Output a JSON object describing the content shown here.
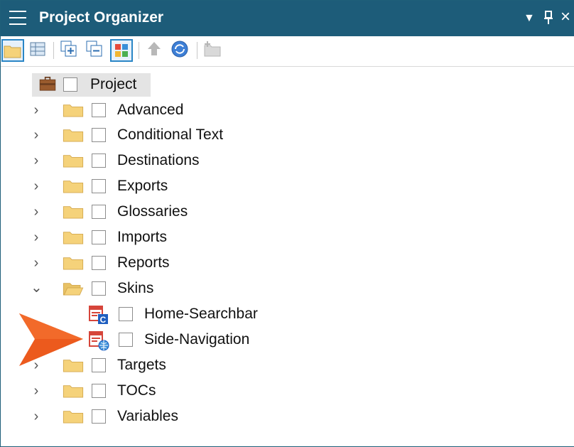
{
  "window": {
    "title": "Project Organizer",
    "menu_glyph": "▼",
    "pin_glyph": "ᵖ",
    "close_glyph": "×"
  },
  "colors": {
    "titlebar": "#1d5c79",
    "folder": "#f5d27a",
    "arrow": "#ec5a1d",
    "skin_icon": "#d6453a",
    "selection_border": "#2a86c6"
  },
  "toolbar": {
    "buttons": [
      {
        "icon": "open-folder-icon",
        "selected": true
      },
      {
        "icon": "grid-view-icon",
        "selected": false
      },
      {
        "icon": "expand-all-icon",
        "selected": false
      },
      {
        "icon": "collapse-all-icon",
        "selected": false
      },
      {
        "icon": "colored-tiles-icon",
        "selected": true
      },
      {
        "icon": "move-up-icon",
        "selected": false
      },
      {
        "icon": "refresh-icon",
        "selected": false
      },
      {
        "icon": "new-folder-icon",
        "selected": false
      }
    ]
  },
  "tree": {
    "root": {
      "label": "Project",
      "icon": "briefcase-icon"
    },
    "items": [
      {
        "label": "Advanced",
        "expanded": false
      },
      {
        "label": "Conditional Text",
        "expanded": false
      },
      {
        "label": "Destinations",
        "expanded": false
      },
      {
        "label": "Exports",
        "expanded": false
      },
      {
        "label": "Glossaries",
        "expanded": false
      },
      {
        "label": "Imports",
        "expanded": false
      },
      {
        "label": "Reports",
        "expanded": false
      },
      {
        "label": "Skins",
        "expanded": true,
        "children": [
          {
            "label": "Home-Searchbar",
            "icon": "skin-component-icon",
            "badge": "C"
          },
          {
            "label": "Side-Navigation",
            "icon": "skin-navigation-icon",
            "badge": "globe"
          }
        ]
      },
      {
        "label": "Targets",
        "expanded": false
      },
      {
        "label": "TOCs",
        "expanded": false
      },
      {
        "label": "Variables",
        "expanded": false
      }
    ],
    "collapsed_glyph": "›",
    "expanded_glyph": "⌄"
  },
  "callout": {
    "icon": "pointer-arrow-icon"
  }
}
